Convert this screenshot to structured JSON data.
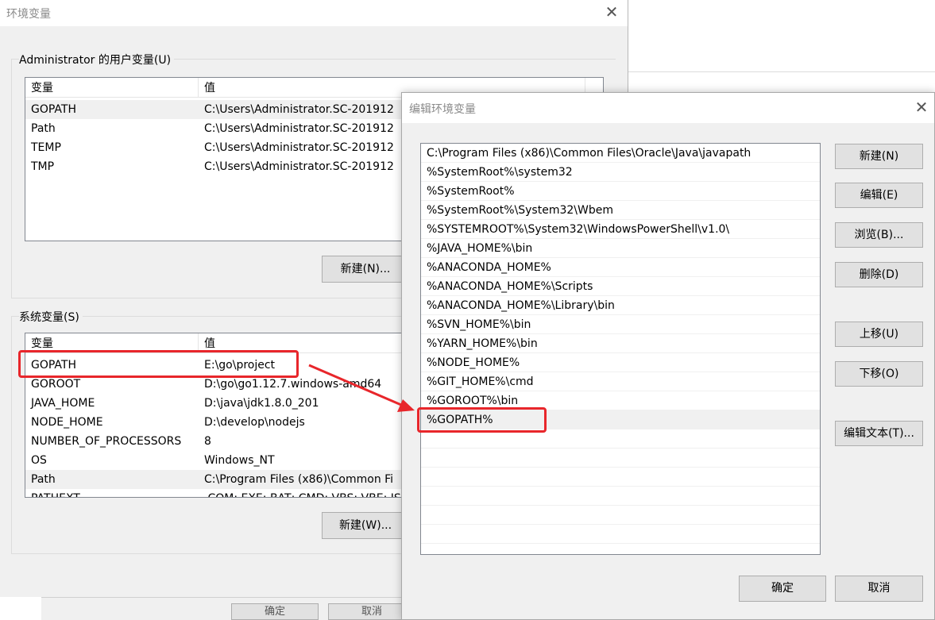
{
  "main_window": {
    "title": "环境变量",
    "user_group_label": "Administrator 的用户变量(U)",
    "system_group_label": "系统变量(S)",
    "col_variable": "变量",
    "col_value": "值",
    "user_vars": [
      {
        "name": "GOPATH",
        "value": "C:\\Users\\Administrator.SC-201912"
      },
      {
        "name": "Path",
        "value": "C:\\Users\\Administrator.SC-201912"
      },
      {
        "name": "TEMP",
        "value": "C:\\Users\\Administrator.SC-201912"
      },
      {
        "name": "TMP",
        "value": "C:\\Users\\Administrator.SC-201912"
      }
    ],
    "system_vars": [
      {
        "name": "GOPATH",
        "value": "E:\\go\\project"
      },
      {
        "name": "GOROOT",
        "value": "D:\\go\\go1.12.7.windows-amd64"
      },
      {
        "name": "JAVA_HOME",
        "value": "D:\\java\\jdk1.8.0_201"
      },
      {
        "name": "NODE_HOME",
        "value": "D:\\develop\\nodejs"
      },
      {
        "name": "NUMBER_OF_PROCESSORS",
        "value": "8"
      },
      {
        "name": "OS",
        "value": "Windows_NT"
      },
      {
        "name": "Path",
        "value": "C:\\Program Files (x86)\\Common Fi"
      },
      {
        "name": "PATHEXT",
        "value": ".COM;.EXE;.BAT;.CMD;.VBS;.VBE;.JS"
      }
    ],
    "user_new_button": "新建(N)...",
    "system_new_button": "新建(W)...",
    "ok_button": "确定",
    "cancel_button": "取消"
  },
  "edit_dialog": {
    "title": "编辑环境变量",
    "paths": [
      "C:\\Program Files (x86)\\Common Files\\Oracle\\Java\\javapath",
      "%SystemRoot%\\system32",
      "%SystemRoot%",
      "%SystemRoot%\\System32\\Wbem",
      "%SYSTEMROOT%\\System32\\WindowsPowerShell\\v1.0\\",
      "%JAVA_HOME%\\bin",
      "%ANACONDA_HOME%",
      "%ANACONDA_HOME%\\Scripts",
      "%ANACONDA_HOME%\\Library\\bin",
      "%SVN_HOME%\\bin",
      "%YARN_HOME%\\bin",
      "%NODE_HOME%",
      "%GIT_HOME%\\cmd",
      "%GOROOT%\\bin",
      "%GOPATH%"
    ],
    "buttons": {
      "new": "新建(N)",
      "edit": "编辑(E)",
      "browse": "浏览(B)...",
      "delete": "删除(D)",
      "move_up": "上移(U)",
      "move_down": "下移(O)",
      "edit_text": "编辑文本(T)...",
      "ok": "确定",
      "cancel": "取消"
    }
  },
  "colors": {
    "annotation": "#e8262b",
    "window_bg": "#f0f0f0",
    "button_bg": "#e1e1e1",
    "button_border": "#adadad",
    "selection_bg": "#f0f0f0"
  }
}
